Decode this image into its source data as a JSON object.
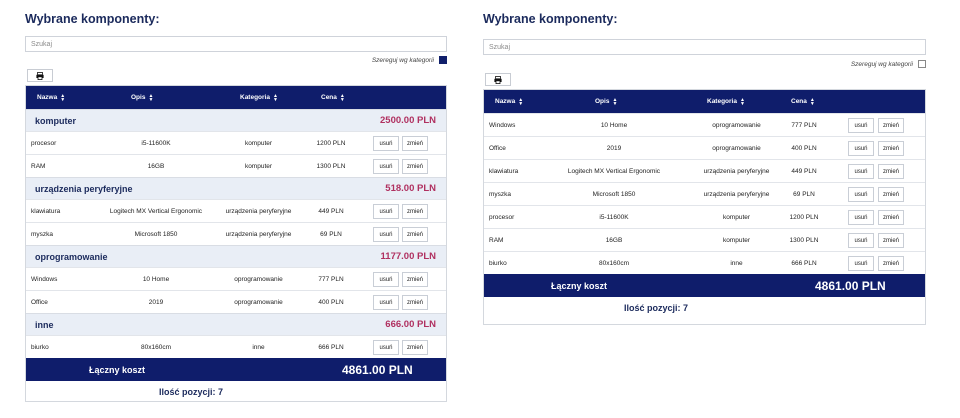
{
  "left": {
    "title": "Wybrane komponenty:",
    "search_placeholder": "Szukaj",
    "group_by_label": "Szereguj wg kategorii",
    "group_by_checked": true,
    "headers": {
      "name": "Nazwa",
      "desc": "Opis",
      "category": "Kategoria",
      "price": "Cena"
    },
    "groups": [
      {
        "name": "komputer",
        "sum": "2500.00 PLN",
        "rows": [
          {
            "name": "procesor",
            "desc": "i5-11600K",
            "category": "komputer",
            "price": "1200 PLN"
          },
          {
            "name": "RAM",
            "desc": "16GB",
            "category": "komputer",
            "price": "1300 PLN"
          }
        ]
      },
      {
        "name": "urządzenia peryferyjne",
        "sum": "518.00 PLN",
        "rows": [
          {
            "name": "klawiatura",
            "desc": "Logitech MX Vertical Ergonomic",
            "category": "urządzenia peryferyjne",
            "price": "449 PLN"
          },
          {
            "name": "myszka",
            "desc": "Microsoft 1850",
            "category": "urządzenia peryferyjne",
            "price": "69 PLN"
          }
        ]
      },
      {
        "name": "oprogramowanie",
        "sum": "1177.00 PLN",
        "rows": [
          {
            "name": "Windows",
            "desc": "10 Home",
            "category": "oprogramowanie",
            "price": "777 PLN"
          },
          {
            "name": "Office",
            "desc": "2019",
            "category": "oprogramowanie",
            "price": "400 PLN"
          }
        ]
      },
      {
        "name": "inne",
        "sum": "666.00 PLN",
        "rows": [
          {
            "name": "biurko",
            "desc": "80x160cm",
            "category": "inne",
            "price": "666 PLN"
          }
        ]
      }
    ],
    "delete_label": "usuń",
    "edit_label": "zmień",
    "total_label": "Łączny koszt",
    "total_value": "4861.00 PLN",
    "count_label": "Ilość pozycji: 7"
  },
  "right": {
    "title": "Wybrane komponenty:",
    "search_placeholder": "Szukaj",
    "group_by_label": "Szereguj wg kategorii",
    "group_by_checked": false,
    "headers": {
      "name": "Nazwa",
      "desc": "Opis",
      "category": "Kategoria",
      "price": "Cena"
    },
    "rows": [
      {
        "name": "Windows",
        "desc": "10 Home",
        "category": "oprogramowanie",
        "price": "777 PLN"
      },
      {
        "name": "Office",
        "desc": "2019",
        "category": "oprogramowanie",
        "price": "400 PLN"
      },
      {
        "name": "klawiatura",
        "desc": "Logitech MX Vertical Ergonomic",
        "category": "urządzenia peryferyjne",
        "price": "449 PLN"
      },
      {
        "name": "myszka",
        "desc": "Microsoft 1850",
        "category": "urządzenia peryferyjne",
        "price": "69 PLN"
      },
      {
        "name": "procesor",
        "desc": "i5-11600K",
        "category": "komputer",
        "price": "1200 PLN"
      },
      {
        "name": "RAM",
        "desc": "16GB",
        "category": "komputer",
        "price": "1300 PLN"
      },
      {
        "name": "biurko",
        "desc": "80x160cm",
        "category": "inne",
        "price": "666 PLN"
      }
    ],
    "delete_label": "usuń",
    "edit_label": "zmień",
    "total_label": "Łączny koszt",
    "total_value": "4861.00 PLN",
    "count_label": "Ilość pozycji: 7"
  }
}
